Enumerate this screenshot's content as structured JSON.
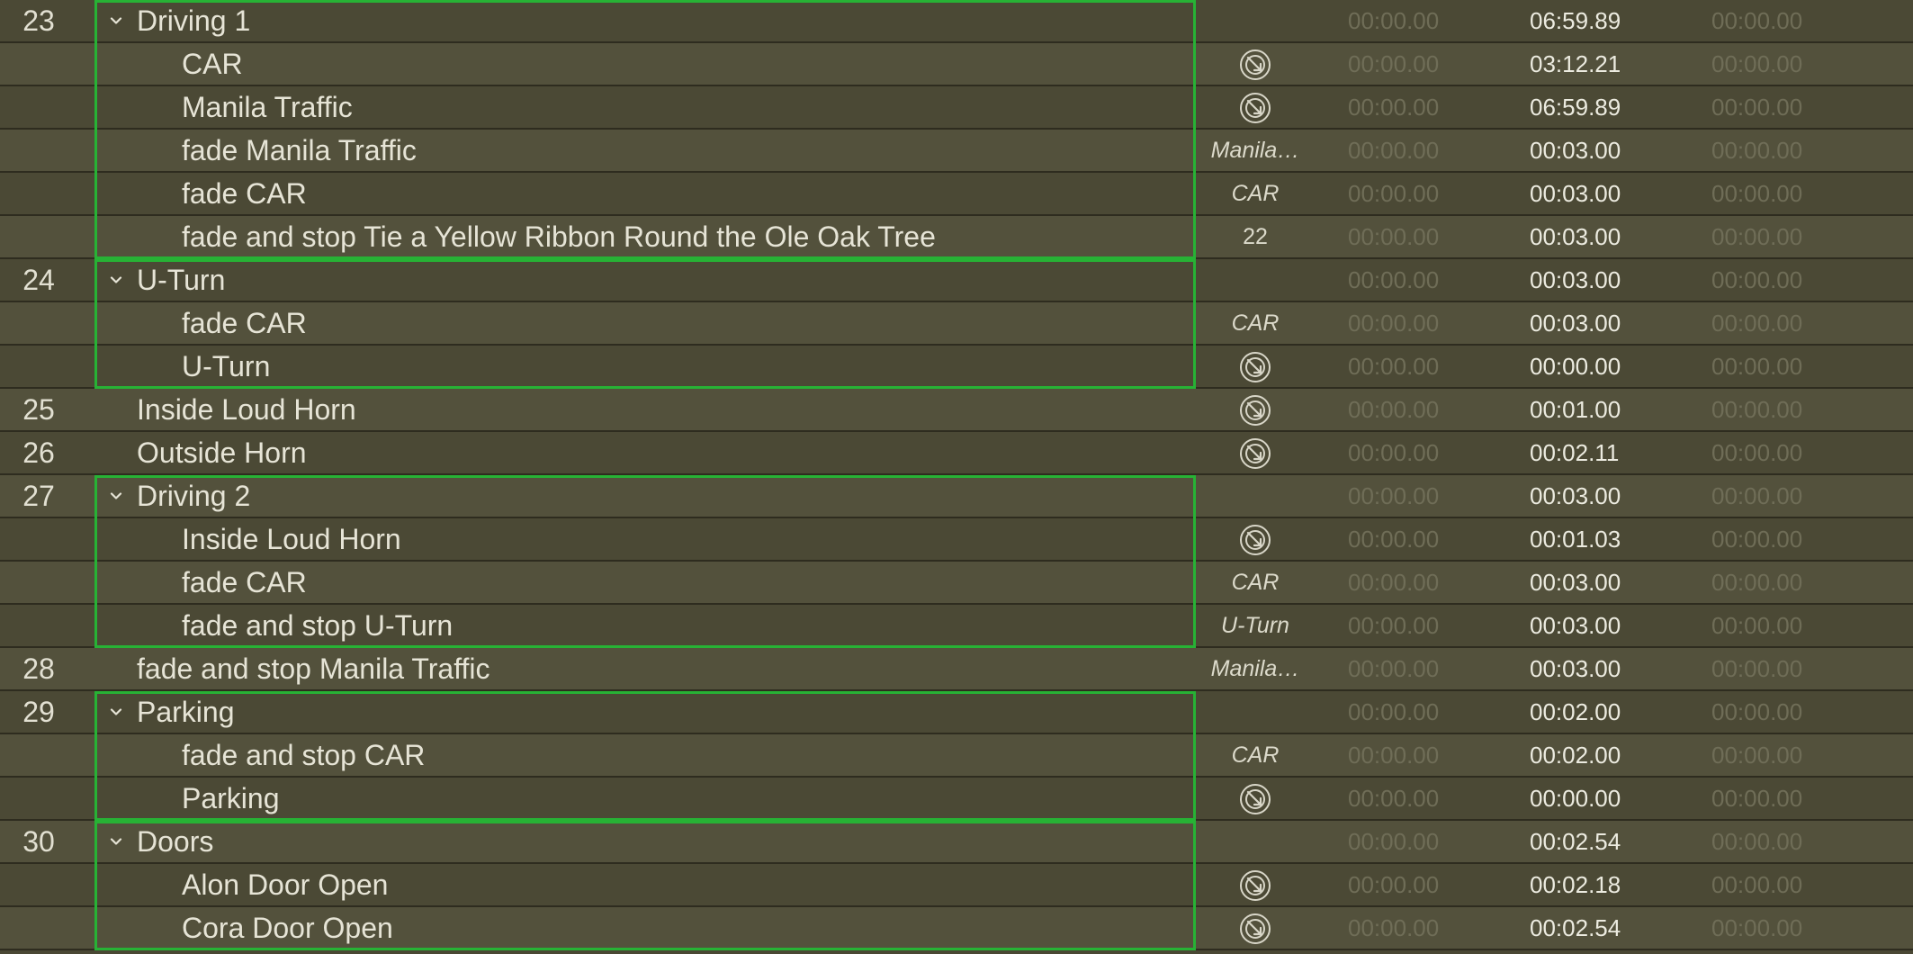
{
  "colors": {
    "group_border": "#27b235",
    "row_dark": "#4b4935",
    "row_light": "#53513c",
    "text": "#e6e4d6",
    "dim_time": "#6f6d57"
  },
  "icons": {
    "disclosure": "chevron-down-icon",
    "target": "audio-target-icon"
  },
  "rows": [
    {
      "number": "23",
      "name": "Driving 1",
      "group": true,
      "child": false,
      "target": "",
      "target_icon": false,
      "pre_wait": "00:00.00",
      "duration": "06:59.89",
      "post_wait": "00:00.00"
    },
    {
      "number": "",
      "name": "CAR",
      "group": false,
      "child": true,
      "target": "",
      "target_icon": true,
      "pre_wait": "00:00.00",
      "duration": "03:12.21",
      "post_wait": "00:00.00"
    },
    {
      "number": "",
      "name": "Manila Traffic",
      "group": false,
      "child": true,
      "target": "",
      "target_icon": true,
      "pre_wait": "00:00.00",
      "duration": "06:59.89",
      "post_wait": "00:00.00"
    },
    {
      "number": "",
      "name": "fade Manila Traffic",
      "group": false,
      "child": true,
      "target": "Manila…",
      "target_icon": false,
      "pre_wait": "00:00.00",
      "duration": "00:03.00",
      "post_wait": "00:00.00"
    },
    {
      "number": "",
      "name": "fade CAR",
      "group": false,
      "child": true,
      "target": "CAR",
      "target_icon": false,
      "pre_wait": "00:00.00",
      "duration": "00:03.00",
      "post_wait": "00:00.00"
    },
    {
      "number": "",
      "name": "fade and stop Tie a Yellow Ribbon Round the Ole Oak Tree",
      "group": false,
      "child": true,
      "target": "22",
      "target_plain": true,
      "target_icon": false,
      "pre_wait": "00:00.00",
      "duration": "00:03.00",
      "post_wait": "00:00.00"
    },
    {
      "number": "24",
      "name": "U-Turn",
      "group": true,
      "child": false,
      "target": "",
      "target_icon": false,
      "pre_wait": "00:00.00",
      "duration": "00:03.00",
      "post_wait": "00:00.00"
    },
    {
      "number": "",
      "name": "fade CAR",
      "group": false,
      "child": true,
      "target": "CAR",
      "target_icon": false,
      "pre_wait": "00:00.00",
      "duration": "00:03.00",
      "post_wait": "00:00.00"
    },
    {
      "number": "",
      "name": "U-Turn",
      "group": false,
      "child": true,
      "target": "",
      "target_icon": true,
      "pre_wait": "00:00.00",
      "duration": "00:00.00",
      "post_wait": "00:00.00"
    },
    {
      "number": "25",
      "name": "Inside Loud Horn",
      "group": false,
      "child": false,
      "target": "",
      "target_icon": true,
      "pre_wait": "00:00.00",
      "duration": "00:01.00",
      "post_wait": "00:00.00"
    },
    {
      "number": "26",
      "name": "Outside Horn",
      "group": false,
      "child": false,
      "target": "",
      "target_icon": true,
      "pre_wait": "00:00.00",
      "duration": "00:02.11",
      "post_wait": "00:00.00"
    },
    {
      "number": "27",
      "name": "Driving 2",
      "group": true,
      "child": false,
      "target": "",
      "target_icon": false,
      "pre_wait": "00:00.00",
      "duration": "00:03.00",
      "post_wait": "00:00.00"
    },
    {
      "number": "",
      "name": "Inside Loud Horn",
      "group": false,
      "child": true,
      "target": "",
      "target_icon": true,
      "pre_wait": "00:00.00",
      "duration": "00:01.03",
      "post_wait": "00:00.00"
    },
    {
      "number": "",
      "name": "fade CAR",
      "group": false,
      "child": true,
      "target": "CAR",
      "target_icon": false,
      "pre_wait": "00:00.00",
      "duration": "00:03.00",
      "post_wait": "00:00.00"
    },
    {
      "number": "",
      "name": "fade and stop U-Turn",
      "group": false,
      "child": true,
      "target": "U-Turn",
      "target_icon": false,
      "pre_wait": "00:00.00",
      "duration": "00:03.00",
      "post_wait": "00:00.00"
    },
    {
      "number": "28",
      "name": "fade and stop Manila Traffic",
      "group": false,
      "child": false,
      "target": "Manila…",
      "target_icon": false,
      "pre_wait": "00:00.00",
      "duration": "00:03.00",
      "post_wait": "00:00.00"
    },
    {
      "number": "29",
      "name": "Parking",
      "group": true,
      "child": false,
      "target": "",
      "target_icon": false,
      "pre_wait": "00:00.00",
      "duration": "00:02.00",
      "post_wait": "00:00.00"
    },
    {
      "number": "",
      "name": "fade and stop CAR",
      "group": false,
      "child": true,
      "target": "CAR",
      "target_icon": false,
      "pre_wait": "00:00.00",
      "duration": "00:02.00",
      "post_wait": "00:00.00"
    },
    {
      "number": "",
      "name": "Parking",
      "group": false,
      "child": true,
      "target": "",
      "target_icon": true,
      "pre_wait": "00:00.00",
      "duration": "00:00.00",
      "post_wait": "00:00.00"
    },
    {
      "number": "30",
      "name": "Doors",
      "group": true,
      "child": false,
      "target": "",
      "target_icon": false,
      "pre_wait": "00:00.00",
      "duration": "00:02.54",
      "post_wait": "00:00.00"
    },
    {
      "number": "",
      "name": "Alon Door Open",
      "group": false,
      "child": true,
      "target": "",
      "target_icon": true,
      "pre_wait": "00:00.00",
      "duration": "00:02.18",
      "post_wait": "00:00.00"
    },
    {
      "number": "",
      "name": "Cora Door Open",
      "group": false,
      "child": true,
      "target": "",
      "target_icon": true,
      "pre_wait": "00:00.00",
      "duration": "00:02.54",
      "post_wait": "00:00.00"
    }
  ],
  "groups": [
    {
      "name": "Driving 1",
      "first_row": 0,
      "row_count": 6
    },
    {
      "name": "U-Turn",
      "first_row": 6,
      "row_count": 3
    },
    {
      "name": "Driving 2",
      "first_row": 11,
      "row_count": 4
    },
    {
      "name": "Parking",
      "first_row": 16,
      "row_count": 3
    },
    {
      "name": "Doors",
      "first_row": 19,
      "row_count": 3
    }
  ]
}
